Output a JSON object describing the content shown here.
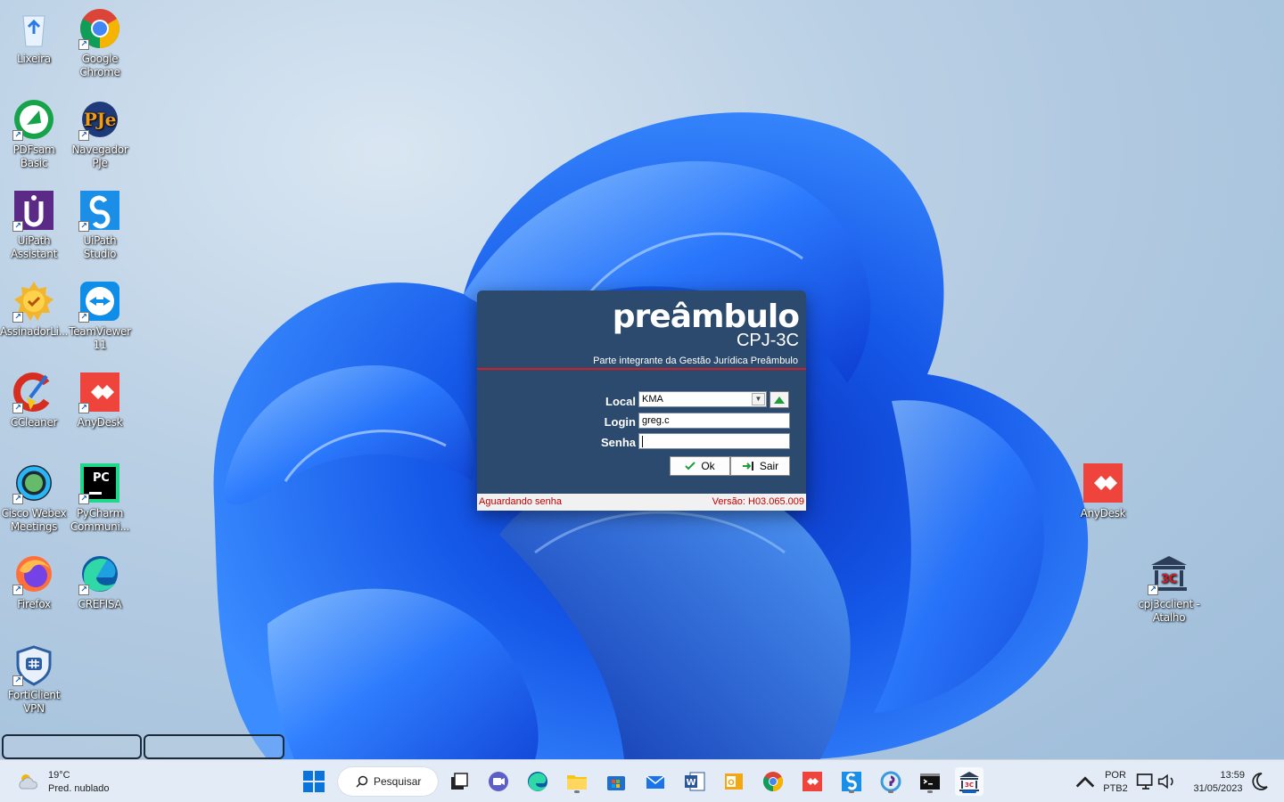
{
  "desktop_icons": [
    {
      "id": "lixeira",
      "label": "Lixeira"
    },
    {
      "id": "chrome",
      "label": "Google Chrome"
    },
    {
      "id": "pdfsam",
      "label": "PDFsam Basic"
    },
    {
      "id": "pje",
      "label": "Navegador PJe"
    },
    {
      "id": "uipath-assistant",
      "label": "UiPath Assistant"
    },
    {
      "id": "uipath-studio",
      "label": "UiPath Studio"
    },
    {
      "id": "assinador",
      "label": "AssinadorLi..."
    },
    {
      "id": "teamviewer",
      "label": "TeamViewer 11"
    },
    {
      "id": "ccleaner",
      "label": "CCleaner"
    },
    {
      "id": "anydesk-left",
      "label": "AnyDesk"
    },
    {
      "id": "webex",
      "label": "Cisco Webex Meetings"
    },
    {
      "id": "pycharm",
      "label": "PyCharm Communi..."
    },
    {
      "id": "firefox",
      "label": "Firefox"
    },
    {
      "id": "crefisa",
      "label": "CREFISA"
    },
    {
      "id": "forticlient",
      "label": "FortiClient VPN"
    },
    {
      "id": "anydesk-right",
      "label": "AnyDesk"
    },
    {
      "id": "cpj3c",
      "label": "cpj3cclient - Atalho"
    }
  ],
  "login_dialog": {
    "brand": "preâmbulo",
    "product": "CPJ-3C",
    "tagline": "Parte integrante da Gestão Jurídica Preâmbulo",
    "local_label": "Local",
    "local_value": "KMA",
    "login_label": "Login",
    "login_value": "greg.c",
    "senha_label": "Senha",
    "senha_value": "",
    "ok_label": "Ok",
    "sair_label": "Sair",
    "status": "Aguardando senha",
    "version": "Versão: H03.065.009"
  },
  "taskbar": {
    "weather_temp": "19°C",
    "weather_desc": "Pred. nublado",
    "search_label": "Pesquisar",
    "lang_top": "POR",
    "lang_bottom": "PTB2",
    "time": "13:59",
    "date": "31/05/2023"
  },
  "colors": {
    "dialog_bg": "#2b4a6e",
    "dialog_accent": "#d21f26",
    "taskbar_bg": "#e3ecf6",
    "active_indicator": "#0a64c9"
  }
}
